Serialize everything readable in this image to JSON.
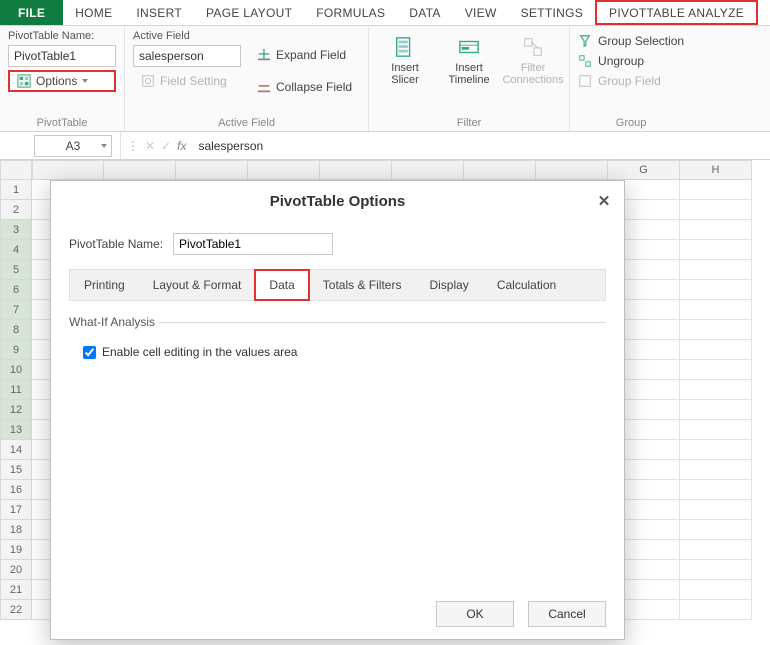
{
  "tabs": {
    "file": "FILE",
    "home": "HOME",
    "insert": "INSERT",
    "page_layout": "PAGE LAYOUT",
    "formulas": "FORMULAS",
    "data": "DATA",
    "view": "VIEW",
    "settings": "SETTINGS",
    "pivot_analyze": "PIVOTTABLE ANALYZE"
  },
  "ribbon": {
    "pivottable": {
      "name_label": "PivotTable Name:",
      "name_value": "PivotTable1",
      "options": "Options",
      "group_label": "PivotTable"
    },
    "activefield": {
      "label": "Active Field",
      "value": "salesperson",
      "field_setting": "Field Setting",
      "expand": "Expand Field",
      "collapse": "Collapse Field",
      "group_label": "Active Field"
    },
    "filter": {
      "insert_slicer": "Insert\nSlicer",
      "insert_timeline": "Insert\nTimeline",
      "filter_connections": "Filter\nConnections",
      "group_label": "Filter"
    },
    "group": {
      "group_selection": "Group Selection",
      "ungroup": "Ungroup",
      "group_field": "Group Field",
      "group_label": "Group"
    }
  },
  "formula_bar": {
    "name_box": "A3",
    "formula": "salesperson"
  },
  "columns": [
    "G",
    "H"
  ],
  "rows": [
    "1",
    "2",
    "3",
    "4",
    "5",
    "6",
    "7",
    "8",
    "9",
    "10",
    "11",
    "12",
    "13",
    "14",
    "15",
    "16",
    "17",
    "18",
    "19",
    "20",
    "21",
    "22"
  ],
  "selected_rows": [
    "3",
    "4",
    "5",
    "6",
    "7",
    "8",
    "9",
    "10",
    "11",
    "12",
    "13"
  ],
  "dialog": {
    "title": "PivotTable Options",
    "name_label": "PivotTable Name:",
    "name_value": "PivotTable1",
    "tabs": {
      "printing": "Printing",
      "layout": "Layout & Format",
      "data": "Data",
      "totals": "Totals & Filters",
      "display": "Display",
      "calculation": "Calculation"
    },
    "section": "What-If Analysis",
    "checkbox": "Enable cell editing in the values area",
    "ok": "OK",
    "cancel": "Cancel"
  }
}
